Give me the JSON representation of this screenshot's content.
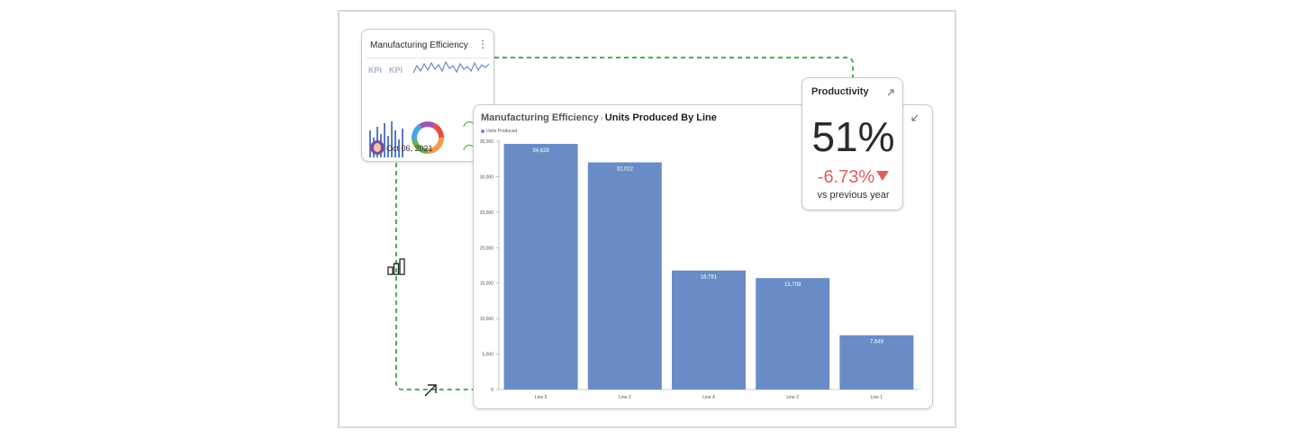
{
  "mini_card": {
    "title": "Manufacturing Efficiency",
    "kpi_labels": [
      "KPI",
      "KPI"
    ],
    "date": "Oct 06, 2021"
  },
  "chart_card": {
    "breadcrumb": "Manufacturing Efficiency",
    "separator": "›",
    "title": "Units Produced By Line"
  },
  "kpi_card": {
    "title": "Productivity",
    "value": "51%",
    "delta": "-6.73%",
    "comparison": "vs previous year",
    "delta_color": "#e06060"
  },
  "colors": {
    "bar": "#6a8cc6",
    "connector": "#4caf50"
  },
  "chart_data": {
    "type": "bar",
    "categories": [
      "Line 5",
      "Line 3",
      "Line 4",
      "Line 2",
      "Line 1"
    ],
    "series": [
      {
        "name": "Units Produced",
        "values": [
          34628,
          32022,
          16781,
          15709,
          7649
        ]
      }
    ],
    "value_labels": [
      "34,628",
      "32,022",
      "16,781",
      "15,709",
      "7,649"
    ],
    "ylim": [
      0,
      35000
    ],
    "yticks": [
      0,
      5000,
      10000,
      15000,
      20000,
      25000,
      30000,
      35000
    ],
    "ytick_labels": [
      "0",
      "5,000",
      "10,000",
      "15,000",
      "20,000",
      "25,000",
      "30,000",
      "35,000"
    ],
    "title": "Units Produced By Line",
    "xlabel": "",
    "ylabel": "",
    "legend": "top-left",
    "grid": false
  }
}
